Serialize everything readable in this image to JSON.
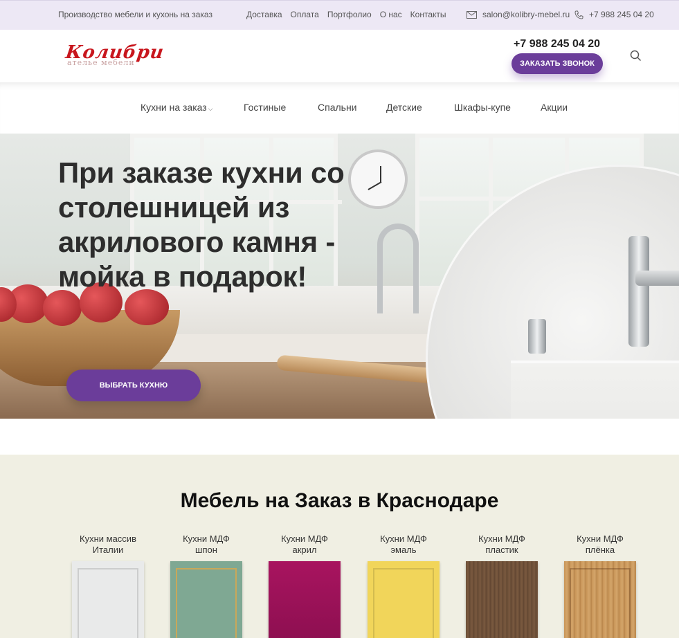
{
  "topbar": {
    "tagline": "Производство мебели и кухонь на заказ",
    "nav": [
      "Доставка",
      "Оплата",
      "Портфолио",
      "О нас",
      "Контакты"
    ],
    "email": "salon@kolibry-mebel.ru",
    "phone": "+7 988 245 04 20"
  },
  "header": {
    "logo_text": "Колибри",
    "logo_subtitle": "ателье мебели",
    "phone": "+7 988 245 04 20",
    "callback_label": "ЗАКАЗАТЬ ЗВОНОК"
  },
  "mainnav": {
    "items": [
      "Кухни на заказ",
      "Гостиные",
      "Спальни",
      "Детские",
      "Шкафы-купе",
      "Акции"
    ]
  },
  "hero": {
    "title": "При заказе кухни со столешницей из акрилового камня - мойка в подарок!",
    "button_label": "ВЫБРАТЬ КУХНЮ"
  },
  "catalog": {
    "title": "Мебель на Заказ в Краснодаре",
    "cards": [
      {
        "line1": "Кухни массив",
        "line2": "Италии",
        "color": "#e9eaea"
      },
      {
        "line1": "Кухни МДФ",
        "line2": "шпон",
        "color": "#7fa893"
      },
      {
        "line1": "Кухни МДФ",
        "line2": "акрил",
        "color": "#9b1257"
      },
      {
        "line1": "Кухни МДФ",
        "line2": "эмаль",
        "color": "#f1d55a"
      },
      {
        "line1": "Кухни МДФ",
        "line2": "пластик",
        "color": "#6b4e37"
      },
      {
        "line1": "Кухни МДФ",
        "line2": "плёнка",
        "color": "#c89558"
      }
    ]
  },
  "colors": {
    "accent": "#6b3d9a",
    "topbar_bg": "#ede8f5",
    "catalog_bg": "#f0efe3",
    "logo_red": "#c8161d"
  },
  "icons": {
    "email": "envelope-icon",
    "phone": "phone-icon",
    "search": "search-icon",
    "dropdown": "chevron-down-icon"
  }
}
